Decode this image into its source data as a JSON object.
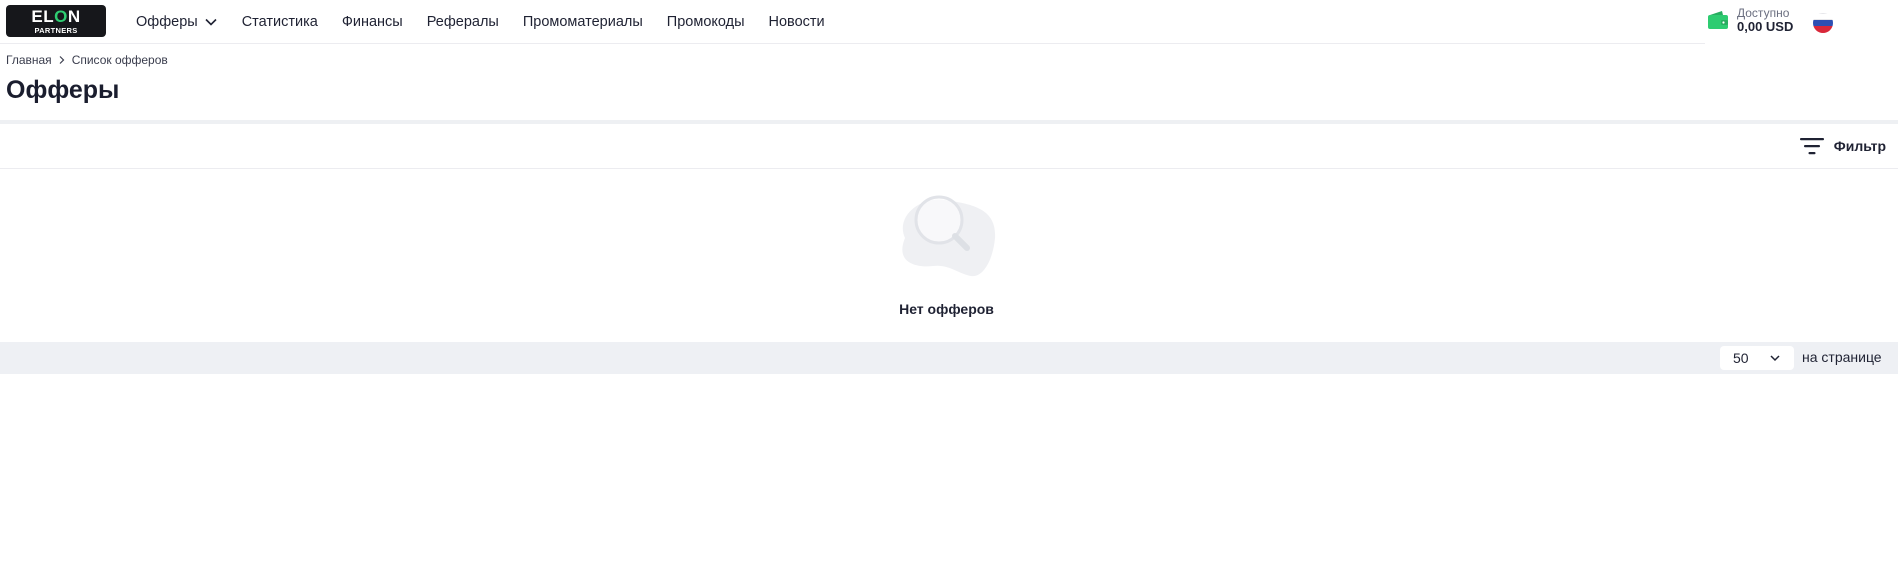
{
  "brand": {
    "logo_line1_a": "EL",
    "logo_line1_b": "O",
    "logo_line1_c": "N",
    "logo_line2": "PARTNERS"
  },
  "nav": {
    "items": [
      {
        "label": "Офферы",
        "has_dropdown": true
      },
      {
        "label": "Статистика"
      },
      {
        "label": "Финансы"
      },
      {
        "label": "Рефералы"
      },
      {
        "label": "Промоматериалы"
      },
      {
        "label": "Промокоды"
      },
      {
        "label": "Новости"
      }
    ]
  },
  "balance": {
    "label": "Доступно",
    "value": "0,00 USD",
    "icon": "wallet-icon"
  },
  "language": {
    "icon": "russia-flag-icon"
  },
  "breadcrumb": {
    "home": "Главная",
    "current": "Список офферов"
  },
  "page": {
    "title": "Офферы"
  },
  "filter": {
    "label": "Фильтр",
    "icon": "filter-icon"
  },
  "empty_state": {
    "text": "Нет офферов",
    "icon": "magnifier-icon"
  },
  "pagination": {
    "per_page_value": "50",
    "per_page_label": "на странице"
  },
  "colors": {
    "accent_green": "#2ecc71",
    "background": "#ffffff",
    "pager_bg": "#eef0f4",
    "text": "#1f2233"
  }
}
